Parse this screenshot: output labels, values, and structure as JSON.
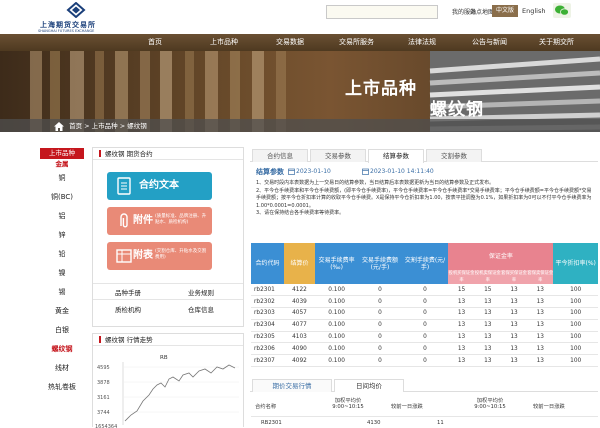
{
  "header": {
    "logo_cn": "上海期货交易所",
    "logo_en": "SHANGHAI FUTURES EXCHANGE",
    "search_placeholder": "",
    "links": [
      "我的服务",
      "站点地图"
    ],
    "lang_cn": "中文版",
    "lang_en": "English",
    "weixin_icon": "wechat-icon"
  },
  "nav": [
    "首页",
    "上市品种",
    "交易数据",
    "交易所服务",
    "法律法规",
    "公告与新闻",
    "关于期交所"
  ],
  "banner": {
    "title": "上市品种",
    "subtitle": "螺纹钢"
  },
  "breadcrumb": [
    "首页",
    "上市品种",
    "螺纹钢"
  ],
  "sidenav": {
    "head": "上市品种",
    "sub": "金属",
    "items": [
      "铜",
      "铜(BC)",
      "铝",
      "锌",
      "铅",
      "镍",
      "锡",
      "黄金",
      "白银",
      "螺纹钢",
      "线材",
      "热轧卷板"
    ],
    "active_index": 9
  },
  "contract_panel": {
    "title": "螺纹钢 期货合约",
    "buttons": [
      {
        "label": "合约文本",
        "note": "",
        "color": "#23a0c5"
      },
      {
        "label": "附件",
        "note": "(质量标准、品牌注册、升贴水、质检机构)",
        "color": "#e98a77"
      },
      {
        "label": "附表",
        "note": "(交割仓库、升贴水及交割费用)",
        "color": "#e98a77"
      }
    ],
    "links": [
      "品种手册",
      "业务规则",
      "质检机构",
      "仓库信息"
    ]
  },
  "trend_panel": {
    "title": "螺纹钢 行情走势",
    "series_label": "RB",
    "y_ticks": [
      "4595",
      "3878",
      "3161",
      "3744",
      "1654364"
    ]
  },
  "tabs": [
    "合约信息",
    "交易参数",
    "结算参数",
    "交割参数"
  ],
  "active_tab": 2,
  "explanation": {
    "title": "结算参数",
    "date_from": "2023-01-10",
    "date_to": "2023-01-10 14:11:40",
    "paragraphs": [
      "1、交易时段内本表数据为上一交易日的结算参数，当日结算后本表数据更新为当日的结算参数及正式发布。",
      "2、平今仓手续费率和平今仓手续费额，(即平今仓手续费率)，平今仓手续费率=平今仓手续费率*交易手续费率；平今仓手续费额=平今仓手续费额*交易手续费额；按平今仓折扣率计算的收取平今仓手续费。X是保持平今仓折扣率为1.00，按表平挂调整为0.1%，如果折扣率为0可以不付平今仓手续费率为1.00*0.0001=0.0001。",
      "3、请在保持结合各手续费率等待费率。"
    ]
  },
  "table": {
    "headers": [
      "合约代码",
      "结算价",
      "交易手续费率(‰)",
      "交易手续费额(元/手)",
      "交割手续费(元/手)",
      "投机买保证金率",
      "投机卖保证金率",
      "套保买保证金率",
      "套保卖保证金率",
      "平今折扣率(%)"
    ],
    "group_header": "保证金率",
    "rows": [
      [
        "rb2301",
        "4122",
        "0.100",
        "0",
        "0",
        "15",
        "15",
        "13",
        "13",
        "100"
      ],
      [
        "rb2302",
        "4039",
        "0.100",
        "0",
        "0",
        "13",
        "13",
        "13",
        "13",
        "100"
      ],
      [
        "rb2303",
        "4057",
        "0.100",
        "0",
        "0",
        "13",
        "13",
        "13",
        "13",
        "100"
      ],
      [
        "rb2304",
        "4077",
        "0.100",
        "0",
        "0",
        "13",
        "13",
        "13",
        "13",
        "100"
      ],
      [
        "rb2305",
        "4103",
        "0.100",
        "0",
        "0",
        "13",
        "13",
        "13",
        "13",
        "100"
      ],
      [
        "rb2306",
        "4090",
        "0.100",
        "0",
        "0",
        "13",
        "13",
        "13",
        "13",
        "100"
      ],
      [
        "rb2307",
        "4092",
        "0.100",
        "0",
        "0",
        "13",
        "13",
        "13",
        "13",
        "100"
      ]
    ]
  },
  "bottom_tabs": [
    "期价交易行情",
    "日间均价"
  ],
  "bottom_active": 1,
  "bottom_table": {
    "headers": [
      "合约名称",
      "加权平均价\n9:00~10:15",
      "较前一日涨跌",
      "加权平均价\n9:00~10:15",
      "较前一日涨跌"
    ],
    "row": [
      "RB2301",
      "4130",
      "11"
    ]
  },
  "colors": {
    "brand_brown": "#5c4328",
    "red": "#c5161d",
    "header_blue": "#3b8fd4",
    "header_pink": "#e8838f",
    "header_teal": "#2fb1c2"
  }
}
